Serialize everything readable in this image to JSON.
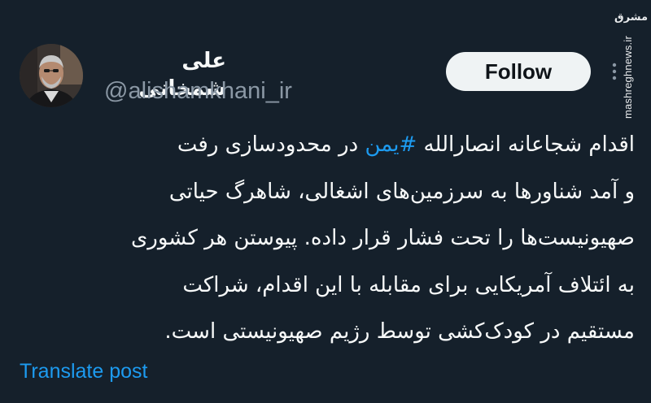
{
  "author": {
    "display_name": "علی شمخانی",
    "handle": "@alishamkhani_ir"
  },
  "actions": {
    "follow_label": "Follow",
    "more_icon": "more-vertical-icon"
  },
  "watermark": {
    "logo_text": "مشرق",
    "site": "mashreghnews.ir"
  },
  "tweet": {
    "line1_before": "اقدام شجاعانه انصارالله ",
    "line1_hashtag": "#یمن",
    "line1_after": " در محدودسازی رفت",
    "line2": "و آمد شناورها به سرزمین‌های اشغالی، شاهرگ حیاتی",
    "line3": "صهیونیست‌ها را تحت فشار قرار داده. پیوستن هر کشوری",
    "line4": "به ائتلاف آمریکایی برای مقابله با این اقدام، شراکت",
    "line5": "مستقیم در کودک‌کشی توسط رژیم صهیونیستی است."
  },
  "translate_label": "Translate post",
  "colors": {
    "background": "#15202b",
    "text": "#f7f9f9",
    "secondary_text": "#8b98a5",
    "link": "#1d9bf0",
    "button_bg": "#eff3f4"
  }
}
